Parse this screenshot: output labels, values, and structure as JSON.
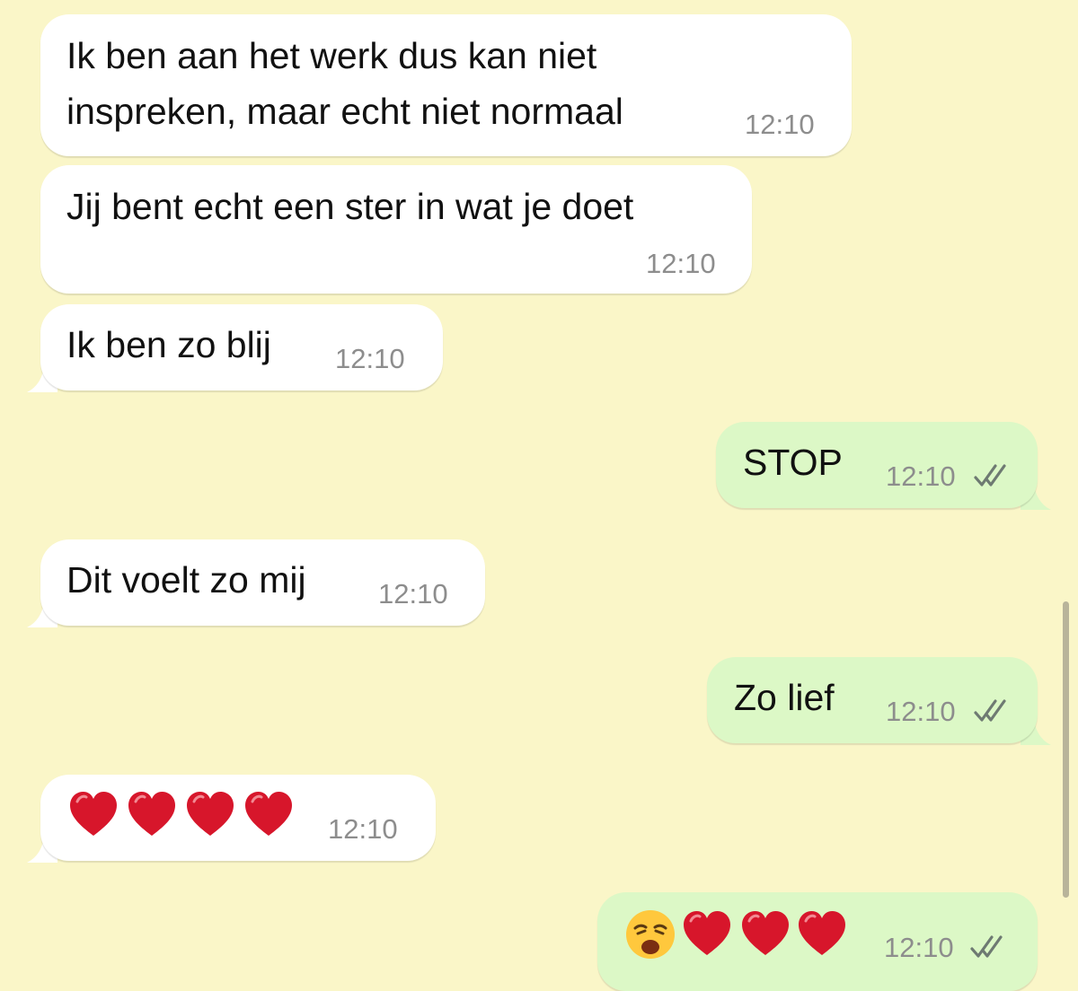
{
  "colors": {
    "background": "#faf6c8",
    "incoming_bubble": "#ffffff",
    "outgoing_bubble": "#dcf8c6",
    "timestamp": "#8d8d8d",
    "heart": "#d7162b",
    "read_ticks": "#6e7a72"
  },
  "messages": [
    {
      "direction": "incoming",
      "lines": [
        "Ik ben aan het werk dus kan niet",
        "inspreken, maar echt niet normaal"
      ],
      "time": "12:10"
    },
    {
      "direction": "incoming",
      "lines": [
        "Jij bent echt een ster in wat je doet"
      ],
      "time": "12:10"
    },
    {
      "direction": "incoming",
      "lines": [
        "Ik ben zo blij"
      ],
      "time": "12:10"
    },
    {
      "direction": "outgoing",
      "lines": [
        "STOP"
      ],
      "time": "12:10",
      "status_icon": "double-check-icon"
    },
    {
      "direction": "incoming",
      "lines": [
        "Dit voelt zo mij"
      ],
      "time": "12:10"
    },
    {
      "direction": "outgoing",
      "lines": [
        "Zo lief"
      ],
      "time": "12:10",
      "status_icon": "double-check-icon"
    },
    {
      "direction": "incoming",
      "emoji": [
        "red-heart",
        "red-heart",
        "red-heart",
        "red-heart"
      ],
      "time": "12:10"
    },
    {
      "direction": "outgoing",
      "emoji": [
        "weary-face",
        "red-heart",
        "red-heart",
        "red-heart"
      ],
      "time": "12:10",
      "status_icon": "double-check-icon"
    }
  ]
}
